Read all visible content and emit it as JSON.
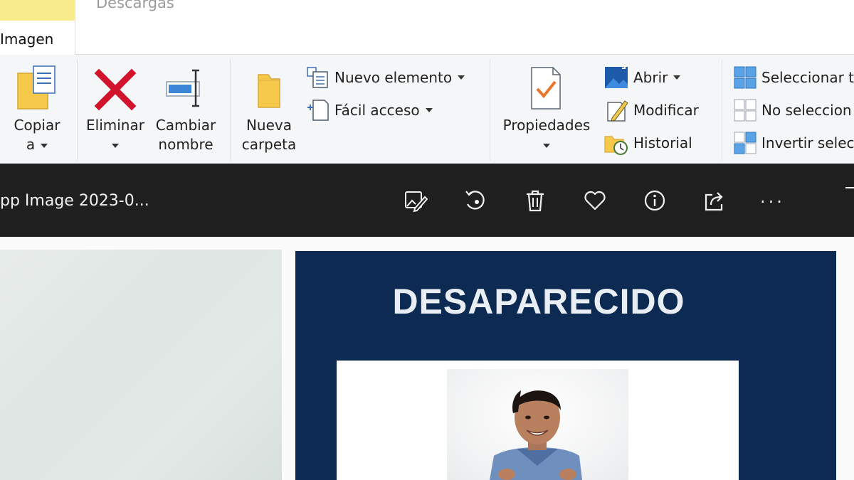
{
  "explorer": {
    "tabs": {
      "active": "Imagen",
      "other": "Descargas"
    },
    "ribbon": {
      "copy_label_1": "Copiar",
      "copy_label_2": "a",
      "delete_label": "Eliminar",
      "rename_label_1": "Cambiar",
      "rename_label_2": "nombre",
      "new_folder_label_1": "Nueva",
      "new_folder_label_2": "carpeta",
      "new_item_label": "Nuevo elemento",
      "easy_access_label": "Fácil acceso",
      "properties_label": "Propiedades",
      "open_label": "Abrir",
      "edit_label": "Modificar",
      "history_label": "Historial",
      "select_all_label": "Seleccionar t",
      "select_none_label": "No seleccion",
      "invert_selection_label": "Invertir selec"
    }
  },
  "photos": {
    "title": "pp Image 2023-0...",
    "toolbar_icons": [
      "edit-image-icon",
      "rotate-icon",
      "trash-icon",
      "heart-icon",
      "info-icon",
      "share-icon"
    ],
    "more": "···"
  },
  "image": {
    "poster_title": "DESAPARECIDO"
  },
  "colors": {
    "ribbon_bg": "#f5f6f7",
    "photobar_bg": "#1f1f1f",
    "poster_bg": "#0d2a52",
    "delete_red": "#d1132c",
    "folder_yellow": "#f6c94a"
  }
}
